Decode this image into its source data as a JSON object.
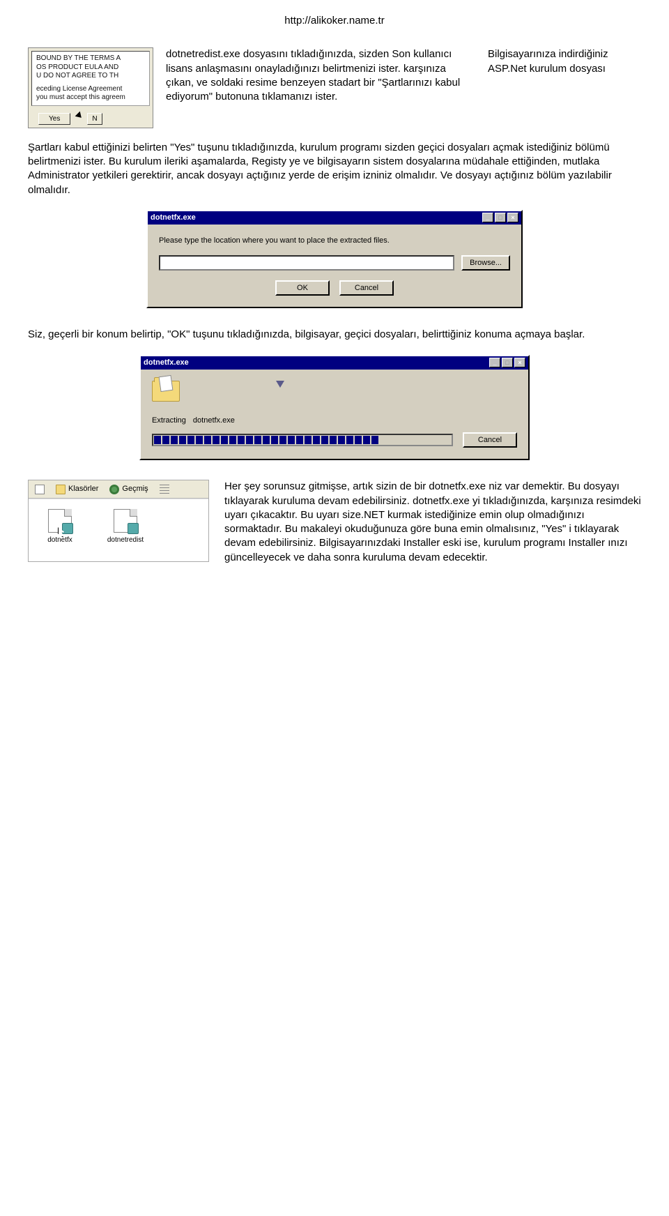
{
  "url": "http://alikoker.name.tr",
  "eula_snippet": {
    "line1": "BOUND BY THE TERMS A",
    "line2": "OS PRODUCT EULA AND",
    "line3": "U DO NOT AGREE TO TH",
    "line4": "eceding License Agreement",
    "line5": "you must accept this agreem",
    "yes": "Yes",
    "no": "N"
  },
  "intro_mid": "dotnetredist.exe dosyasını tıkladığınızda, sizden Son kullanıcı lisans anlaşmasını onayladığınızı belirtmenizi ister. karşınıza çıkan, ve soldaki resime benzeyen stadart bir \"Şartlarınızı kabul ediyorum\" butonuna tıklamanızı ister.",
  "intro_right": "Bilgisayarınıza indirdiğiniz ASP.Net kurulum dosyası",
  "para1": "Şartları kabul ettiğinizi belirten \"Yes\" tuşunu tıkladığınızda, kurulum programı sizden geçici dosyaları açmak istediğiniz bölümü belirtmenizi ister. Bu kurulum ileriki aşamalarda, Registy ye ve bilgisayarın sistem dosyalarına müdahale ettiğinden, mutlaka Administrator yetkileri gerektirir, ancak dosyayı açtığınız yerde de erişim izniniz olmalıdır. Ve dosyayı açtığınız bölüm yazılabilir olmalıdır.",
  "dlg1": {
    "title": "dotnetfx.exe",
    "msg": "Please type the location where you want to place the extracted files.",
    "browse": "Browse...",
    "ok": "OK",
    "cancel": "Cancel"
  },
  "para2": "Siz, geçerli bir konum belirtip, \"OK\" tuşunu tıkladığınızda, bilgisayar, geçici dosyaları, belirttiğiniz konuma açmaya başlar.",
  "dlg2": {
    "title": "dotnetfx.exe",
    "extracting_label": "Extracting",
    "extracting_file": "dotnetfx.exe",
    "cancel": "Cancel"
  },
  "toolbar": {
    "folders": "Klasörler",
    "history": "Geçmiş"
  },
  "files": {
    "f1": "dotnetfx",
    "f2": "dotnetredist"
  },
  "para3": "Her şey sorunsuz gitmişse, artık sizin de bir dotnetfx.exe niz var demektir. Bu dosyayı tıklayarak kuruluma devam edebilirsiniz. dotnetfx.exe yi tıkladığınızda, karşınıza resimdeki uyarı çıkacaktır. Bu uyarı size.NET kurmak istediğinize emin olup olmadığınızı sormaktadır. Bu makaleyi okuduğunuza göre buna emin olmalısınız, \"Yes\" i tıklayarak devam edebilirsiniz. Bilgisayarınızdaki Installer eski ise, kurulum programı Installer ınızı güncelleyecek ve daha sonra kuruluma devam edecektir."
}
